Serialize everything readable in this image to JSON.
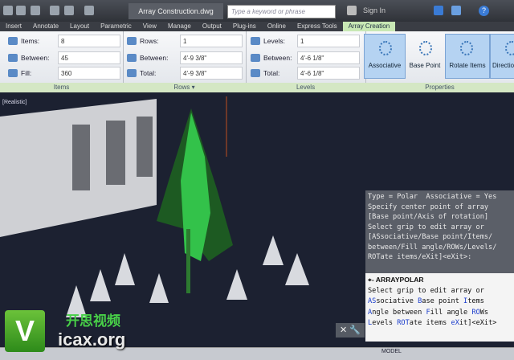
{
  "titlebar": {
    "document_title": "Array Construction.dwg",
    "search_placeholder": "Type a keyword or phrase",
    "sign_in": "Sign In",
    "help": "?"
  },
  "tabs": [
    "Insert",
    "Annotate",
    "Layout",
    "Parametric",
    "View",
    "Manage",
    "Output",
    "Plug-ins",
    "Online",
    "Express Tools",
    "Array Creation"
  ],
  "active_tab": "Array Creation",
  "items_panel": {
    "items_label": "Items:",
    "items_value": "8",
    "between_label": "Between:",
    "between_value": "45",
    "fill_label": "Fill:",
    "fill_value": "360",
    "title": "Items"
  },
  "rows_panel": {
    "rows_label": "Rows:",
    "rows_value": "1",
    "between_label": "Between:",
    "between_value": "4'-9 3/8\"",
    "total_label": "Total:",
    "total_value": "4'-9 3/8\"",
    "title": "Rows ▾"
  },
  "levels_panel": {
    "levels_label": "Levels:",
    "levels_value": "1",
    "between_label": "Between:",
    "between_value": "4'-6 1/8\"",
    "total_label": "Total:",
    "total_value": "4'-6 1/8\"",
    "title": "Levels"
  },
  "properties_panel": {
    "title": "Properties",
    "buttons": [
      "Associative",
      "Base Point",
      "Rotate Items",
      "Directio"
    ]
  },
  "viewport": {
    "label": "[Realistic]"
  },
  "command": {
    "history": [
      "Type = Polar  Associative = Yes",
      "Specify center point of array",
      "[Base point/Axis of rotation]",
      "Select grip to edit array or",
      "[ASsociative/Base point/Items/",
      "between/Fill angle/ROWs/Levels/",
      "ROTate items/eXit]<eXit>:"
    ],
    "name": "ARRAYPOLAR",
    "prompt": "Select grip to edit array or",
    "opt1": [
      "AS",
      "sociative ",
      "B",
      "ase point ",
      "I",
      "tems"
    ],
    "opt2": [
      "A",
      "ngle between ",
      "F",
      "ill angle ",
      "RO",
      "Ws"
    ],
    "opt3": [
      "L",
      "evels ",
      "ROT",
      "ate items ",
      "eX",
      "it]<eXit>"
    ]
  },
  "status": {
    "model": "MODEL"
  },
  "watermark": {
    "logo": "V",
    "chinese": "开思视频",
    "url": "icax.org"
  }
}
